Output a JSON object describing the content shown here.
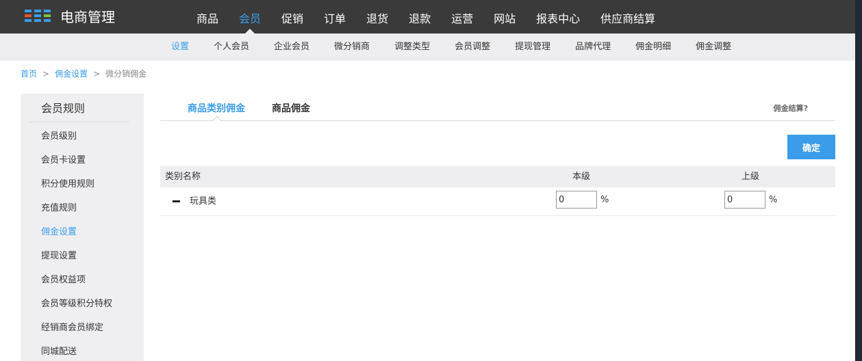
{
  "app": {
    "title": "电商管理",
    "logo_colors": [
      "#3b9dea",
      "#3b9dea",
      "#3b9dea",
      "#e8542f",
      "#3b9dea",
      "#7cc242",
      "#3b9dea",
      "#3b9dea",
      "#3b9dea"
    ]
  },
  "topnav": {
    "active_index": 1,
    "items": [
      "商品",
      "会员",
      "促销",
      "订单",
      "退货",
      "退款",
      "运营",
      "网站",
      "报表中心",
      "供应商结算"
    ]
  },
  "subnav": {
    "active_index": 0,
    "items": [
      "设置",
      "个人会员",
      "企业会员",
      "微分销商",
      "调整类型",
      "会员调整",
      "提现管理",
      "品牌代理",
      "佣金明细",
      "佣金调整"
    ]
  },
  "breadcrumb": {
    "home": "首页",
    "parent": "佣金设置",
    "current": "微分销佣金",
    "separator": ">"
  },
  "sidebar": {
    "title": "会员规则",
    "active_index": 4,
    "items": [
      "会员级别",
      "会员卡设置",
      "积分使用规则",
      "充值规则",
      "佣金设置",
      "提现设置",
      "会员权益项",
      "会员等级积分特权",
      "经销商会员绑定",
      "同城配送"
    ]
  },
  "tabs": {
    "active_index": 0,
    "items": [
      "商品类别佣金",
      "商品佣金"
    ],
    "help_link": "佣金结算?"
  },
  "confirm_label": "确定",
  "table": {
    "headers": {
      "name": "类别名称",
      "own": "本级",
      "upper": "上级"
    },
    "rows": [
      {
        "name": "玩具类",
        "own": "0",
        "upper": "0",
        "unit": "%"
      }
    ]
  },
  "colors": {
    "accent": "#3b9dea",
    "topbar": "#3a3a3a",
    "subnav": "#eeeef0",
    "sidebar": "#efeff1"
  }
}
